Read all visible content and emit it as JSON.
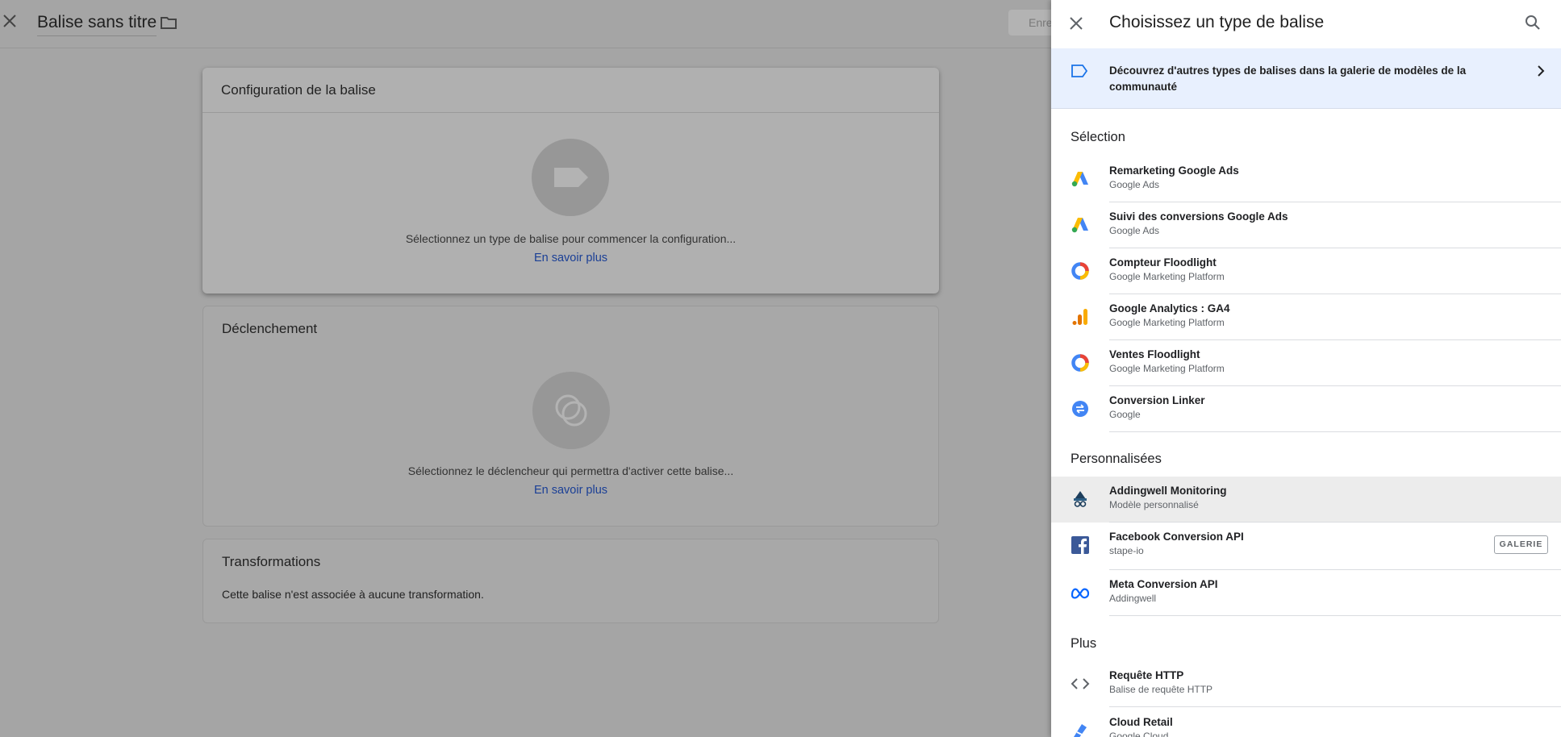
{
  "page": {
    "title": "Balise sans titre",
    "save_label": "Enregistrer",
    "cards": {
      "config": {
        "heading": "Configuration de la balise",
        "message": "Sélectionnez un type de balise pour commencer la configuration...",
        "link": "En savoir plus"
      },
      "trigger": {
        "heading": "Déclenchement",
        "message": "Sélectionnez le déclencheur qui permettra d'activer cette balise...",
        "link": "En savoir plus"
      },
      "transformations": {
        "heading": "Transformations",
        "message": "Cette balise n'est associée à aucune transformation."
      }
    }
  },
  "panel": {
    "title": "Choisissez un type de balise",
    "banner": "Découvrez d'autres types de balises dans la galerie de modèles de la communauté",
    "sections": {
      "selection": {
        "heading": "Sélection",
        "items": [
          {
            "name": "Remarketing Google Ads",
            "sub": "Google Ads",
            "icon": "google-ads-icon"
          },
          {
            "name": "Suivi des conversions Google Ads",
            "sub": "Google Ads",
            "icon": "google-ads-icon"
          },
          {
            "name": "Compteur Floodlight",
            "sub": "Google Marketing Platform",
            "icon": "floodlight-icon"
          },
          {
            "name": "Google Analytics : GA4",
            "sub": "Google Marketing Platform",
            "icon": "analytics-icon"
          },
          {
            "name": "Ventes Floodlight",
            "sub": "Google Marketing Platform",
            "icon": "floodlight-icon"
          },
          {
            "name": "Conversion Linker",
            "sub": "Google",
            "icon": "conversion-linker-icon"
          }
        ]
      },
      "custom": {
        "heading": "Personnalisées",
        "items": [
          {
            "name": "Addingwell Monitoring",
            "sub": "Modèle personnalisé",
            "icon": "addingwell-icon"
          },
          {
            "name": "Facebook Conversion API",
            "sub": "stape-io",
            "icon": "facebook-icon",
            "badge": "GALERIE"
          },
          {
            "name": "Meta Conversion API",
            "sub": "Addingwell",
            "icon": "meta-icon"
          }
        ]
      },
      "more": {
        "heading": "Plus",
        "items": [
          {
            "name": "Requête HTTP",
            "sub": "Balise de requête HTTP",
            "icon": "code-icon"
          },
          {
            "name": "Cloud Retail",
            "sub": "Google Cloud",
            "icon": "cloud-retail-icon"
          }
        ]
      }
    }
  },
  "colors": {
    "accent_blue": "#1a73e8",
    "banner_bg": "#e8f0fe",
    "overlay_bg": "#a5a5a5"
  }
}
